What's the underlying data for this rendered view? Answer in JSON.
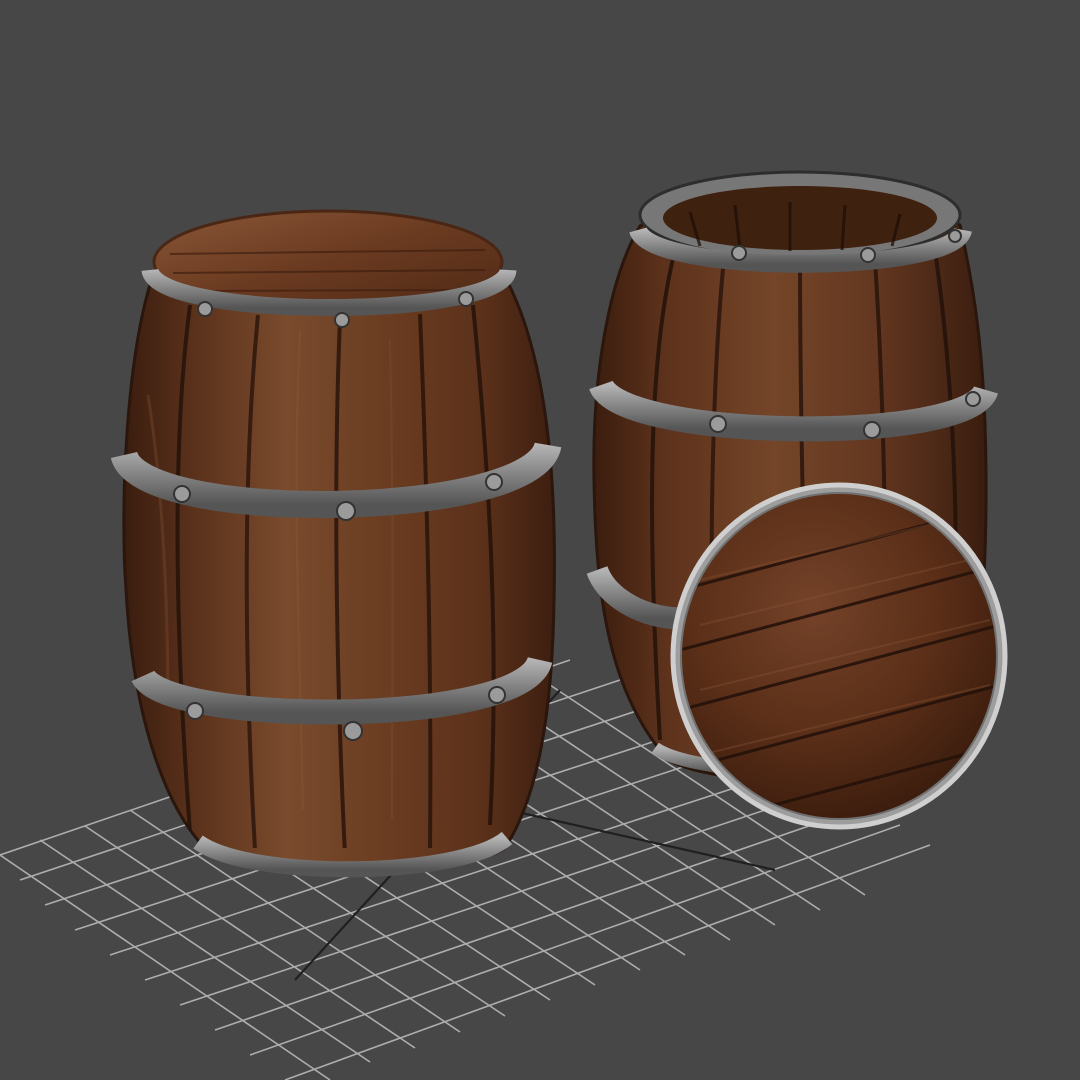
{
  "viewport": {
    "background_color": "#474747",
    "grid_color": "#b9b9b9",
    "grid_axis_color": "#202020"
  },
  "objects": [
    {
      "name": "closed-barrel",
      "wood_color": "#6b3d22",
      "band_color": "#8d8d8d",
      "lid": "closed"
    },
    {
      "name": "open-barrel",
      "wood_color": "#68391f",
      "band_color": "#8b8b8b",
      "lid": "open"
    },
    {
      "name": "barrel-lid",
      "wood_color": "#5f3118",
      "rim_color": "#9c9c9c"
    }
  ]
}
